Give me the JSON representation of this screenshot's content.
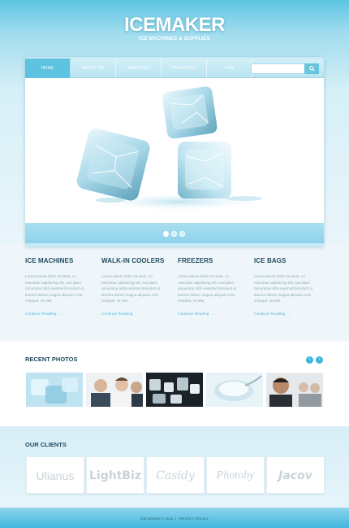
{
  "brand": {
    "title": "ICEMAKER",
    "subtitle": "ICE MACHINES & SUPPLIES"
  },
  "nav": {
    "items": [
      {
        "label": "HOME",
        "active": true
      },
      {
        "label": "ABOUT US",
        "active": false
      },
      {
        "label": "SERVICES",
        "active": false
      },
      {
        "label": "PRODUCTS",
        "active": false
      },
      {
        "label": "FAQ",
        "active": false
      }
    ],
    "search_icon": "search-icon"
  },
  "slider": {
    "slide_count": 3,
    "active_index": 0
  },
  "features": [
    {
      "title": "ICE MACHINES",
      "text": "Lorem ipsum dolor sit amet, co nsectetur adipiscing elit, sed diam nonummy nibh euismod tincidunt ut laoreet dolore magna aliquam erat volutpat. Ut wisi.",
      "link": "Continue Reading"
    },
    {
      "title": "WALK-IN COOLERS",
      "text": "Lorem ipsum dolor sit amet, co nsectetur adipiscing elit, sed diam nonummy nibh euismod tincidunt ut laoreet dolore magna aliquam erat volutpat. Ut wisi.",
      "link": "Continue Reading"
    },
    {
      "title": "FREEZERS",
      "text": "Lorem ipsum dolor sit amet, co nsectetur adipiscing elit, sed diam nonummy nibh euismod tincidunt ut laoreet dolore magna aliquam erat volutpat. Ut wisi.",
      "link": "Continue Reading"
    },
    {
      "title": "ICE BAGS",
      "text": "Lorem ipsum dolor sit amet, co nsectetur adipiscing elit, sed diam nonummy nibh euismod tincidunt ut laoreet dolore magna aliquam erat volutpat. Ut wisi.",
      "link": "Continue Reading"
    }
  ],
  "recent_photos": {
    "title": "RECENT PHOTOS",
    "prev_icon": "chevron-left-icon",
    "next_icon": "chevron-right-icon"
  },
  "clients": {
    "title": "OUR CLIENTS",
    "items": [
      "Ulianus",
      "LightBiz",
      "Casidy",
      "Photoby",
      "Jacov"
    ]
  },
  "footer": {
    "copyright": "ICE MAKER © 2012",
    "separator": "|",
    "privacy": "PRIVACY POLICY"
  },
  "colors": {
    "accent": "#3fb4d8",
    "heading": "#1e4b5e",
    "link": "#5ab9d8"
  }
}
